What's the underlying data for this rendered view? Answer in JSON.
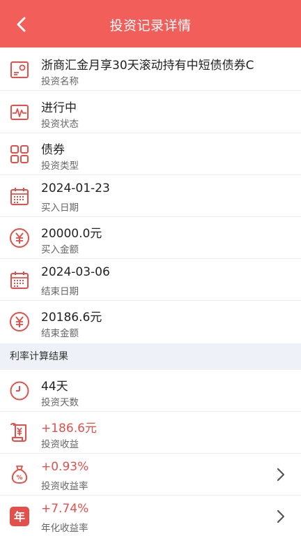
{
  "header": {
    "title": "投资记录详情"
  },
  "details": [
    {
      "value": "浙商汇金月享30天滚动持有中短债债券C",
      "label": "投资名称",
      "icon": "card-icon"
    },
    {
      "value": "进行中",
      "label": "投资状态",
      "icon": "pulse-icon"
    },
    {
      "value": "债券",
      "label": "投资类型",
      "icon": "grid-icon"
    },
    {
      "value": "2024-01-23",
      "label": "买入日期",
      "icon": "calendar-icon"
    },
    {
      "value": "20000.0元",
      "label": "买入金额",
      "icon": "yen-icon"
    },
    {
      "value": "2024-03-06",
      "label": "结束日期",
      "icon": "calendar-icon"
    },
    {
      "value": "20186.6元",
      "label": "结束金额",
      "icon": "yen-icon"
    }
  ],
  "section": {
    "title": "利率计算结果"
  },
  "results": [
    {
      "value": "44天",
      "label": "投资天数",
      "icon": "clock-icon"
    },
    {
      "value": "+186.6元",
      "label": "投资收益",
      "icon": "scroll-yen-icon"
    },
    {
      "value": "+0.93%",
      "label": "投资收益率",
      "icon": "money-bag-icon"
    },
    {
      "value": "+7.74%",
      "label": "年化收益率",
      "icon": "year-badge-icon",
      "badge_text": "年"
    }
  ],
  "colors": {
    "header": "#f25f5a",
    "accent": "#e2504b",
    "section_bg": "#eef1f7"
  }
}
